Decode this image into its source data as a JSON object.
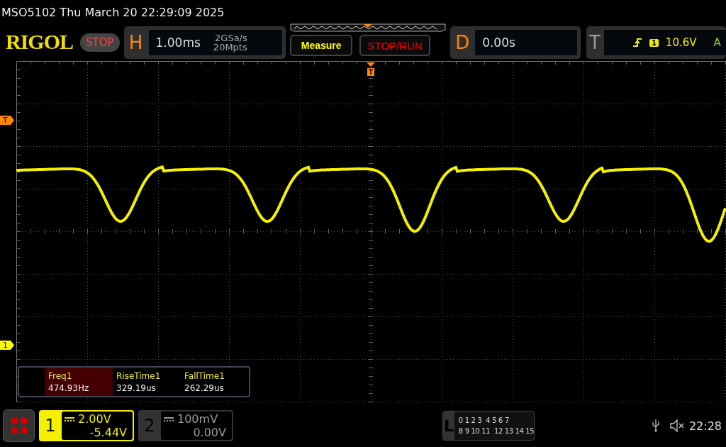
{
  "title": "MSO5102  Thu March 20 22:29:09 2025",
  "logo": "RIGOL",
  "run_state": "STOP",
  "horizontal": {
    "label": "H",
    "timebase": "1.00ms",
    "sample_rate": "2GSa/s",
    "memory_depth": "20Mpts"
  },
  "buttons": [
    {
      "label": "Measure",
      "kind": "measure"
    },
    {
      "label": "STOP/RUN",
      "kind": "stoprun"
    }
  ],
  "delay": {
    "label": "D",
    "value": "0.00s"
  },
  "trigger": {
    "label": "T",
    "channel": "1",
    "trigger_level": "10.6V",
    "mode": "A"
  },
  "markers": [
    {
      "label": "T",
      "kind": "trigger"
    },
    {
      "label": "1",
      "kind": "channel"
    }
  ],
  "measurements": [
    {
      "name": "Freq1",
      "value": "474.93Hz",
      "selected": true
    },
    {
      "name": "RiseTime1",
      "value": "329.19us",
      "selected": false
    },
    {
      "name": "FallTime1",
      "value": "262.29us",
      "selected": false
    }
  ],
  "channels": [
    {
      "number": "1",
      "scale": "2.00V",
      "offset": "-5.44V",
      "selected": true
    },
    {
      "number": "2",
      "scale": "100mV",
      "offset": "0.00V",
      "selected": false
    }
  ],
  "logic": {
    "label": "L",
    "rows": [
      [
        [
          "0",
          "1",
          "2",
          "3"
        ],
        [
          "4",
          "5",
          "6",
          "7"
        ]
      ],
      [
        [
          "8",
          "9",
          "10",
          "11"
        ],
        [
          "12",
          "13",
          "14",
          "15"
        ]
      ]
    ]
  },
  "status": {
    "time": "22:28"
  }
}
